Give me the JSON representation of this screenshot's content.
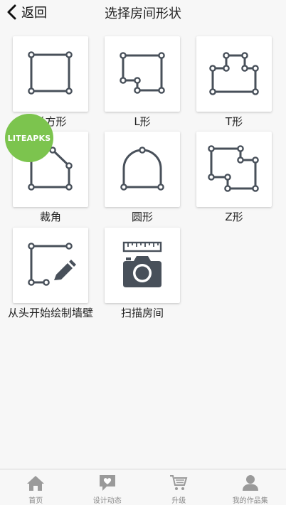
{
  "header": {
    "back_label": "返回",
    "title": "选择房间形状"
  },
  "shapes": [
    {
      "label": "长方形",
      "icon": "rectangle-shape-icon"
    },
    {
      "label": "L形",
      "icon": "l-shape-icon"
    },
    {
      "label": "T形",
      "icon": "t-shape-icon"
    },
    {
      "label": "裁角",
      "icon": "cut-corner-shape-icon"
    },
    {
      "label": "圆形",
      "icon": "arch-shape-icon"
    },
    {
      "label": "Z形",
      "icon": "z-shape-icon"
    },
    {
      "label": "从头开始绘制墙壁",
      "icon": "draw-wall-icon"
    },
    {
      "label": "扫描房间",
      "icon": "scan-camera-icon"
    }
  ],
  "watermark": "LITEAPKS",
  "tabs": [
    {
      "label": "首页",
      "icon": "home-icon"
    },
    {
      "label": "设计动态",
      "icon": "chat-heart-icon"
    },
    {
      "label": "升级",
      "icon": "cart-icon"
    },
    {
      "label": "我的作品集",
      "icon": "person-icon"
    }
  ],
  "colors": {
    "icon_stroke": "#48505a",
    "badge": "#7cc44e",
    "tab_icon": "#9a9a9a"
  }
}
